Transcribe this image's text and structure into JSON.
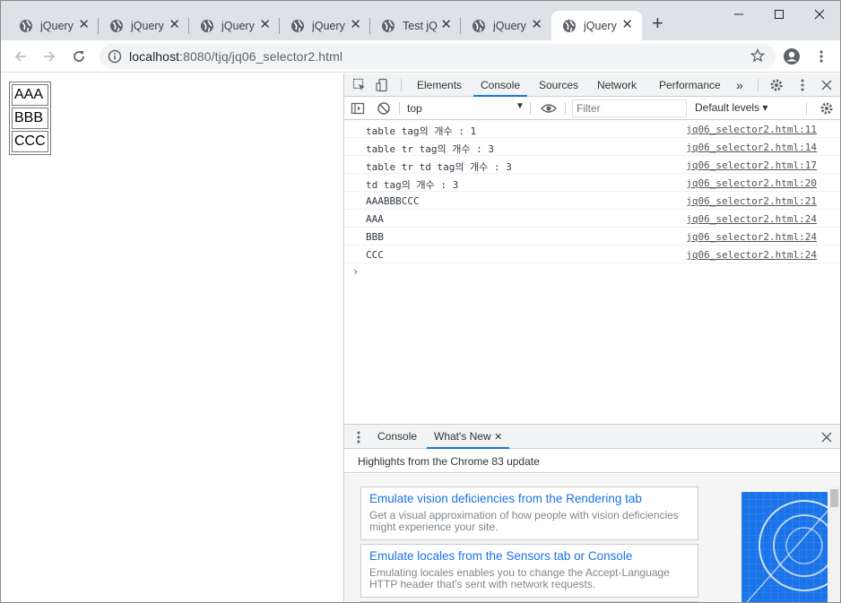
{
  "browser": {
    "tabs": [
      {
        "title": "jQuery",
        "active": false
      },
      {
        "title": "jQuery",
        "active": false
      },
      {
        "title": "jQuery",
        "active": false
      },
      {
        "title": "jQuery",
        "active": false
      },
      {
        "title": "Test jQ",
        "active": false
      },
      {
        "title": "jQuery",
        "active": false
      },
      {
        "title": "jQuery",
        "active": true
      }
    ],
    "new_tab_icon": "plus-icon",
    "url_host": "localhost",
    "url_rest": ":8080/tjq/jq06_selector2.html"
  },
  "page": {
    "table_cells": [
      "AAA",
      "BBB",
      "CCC"
    ]
  },
  "devtools": {
    "tabs": [
      "Elements",
      "Console",
      "Sources",
      "Network",
      "Performance"
    ],
    "active_tab": "Console",
    "more_tabs": "»",
    "context": "top",
    "filter_placeholder": "Filter",
    "levels": "Default levels ▾",
    "logs": [
      {
        "msg": "table tag의 개수 : 1",
        "src": "jq06_selector2.html:11"
      },
      {
        "msg": "table tr tag의 개수 : 3",
        "src": "jq06_selector2.html:14"
      },
      {
        "msg": "table tr td tag의 개수 : 3",
        "src": "jq06_selector2.html:17"
      },
      {
        "msg": "td tag의 개수 : 3",
        "src": "jq06_selector2.html:20"
      },
      {
        "msg": "AAABBBCCC",
        "src": "jq06_selector2.html:21"
      },
      {
        "msg": "AAA",
        "src": "jq06_selector2.html:24"
      },
      {
        "msg": "BBB",
        "src": "jq06_selector2.html:24"
      },
      {
        "msg": "CCC",
        "src": "jq06_selector2.html:24"
      }
    ],
    "prompt": "›",
    "drawer": {
      "tabs": [
        "Console",
        "What's New"
      ],
      "active_tab": "What's New",
      "highlights": "Highlights from the Chrome 83 update",
      "cards": [
        {
          "title": "Emulate vision deficiencies from the Rendering tab",
          "desc": "Get a visual approximation of how people with vision deficiencies might experience your site."
        },
        {
          "title": "Emulate locales from the Sensors tab or Console",
          "desc": "Emulating locales enables you to change the Accept-Language HTTP header that's sent with network requests."
        }
      ]
    }
  },
  "colors": {
    "accent": "#1a73e8",
    "tabstrip": "#dee1e6",
    "devtools_bar": "#f1f3f4"
  }
}
